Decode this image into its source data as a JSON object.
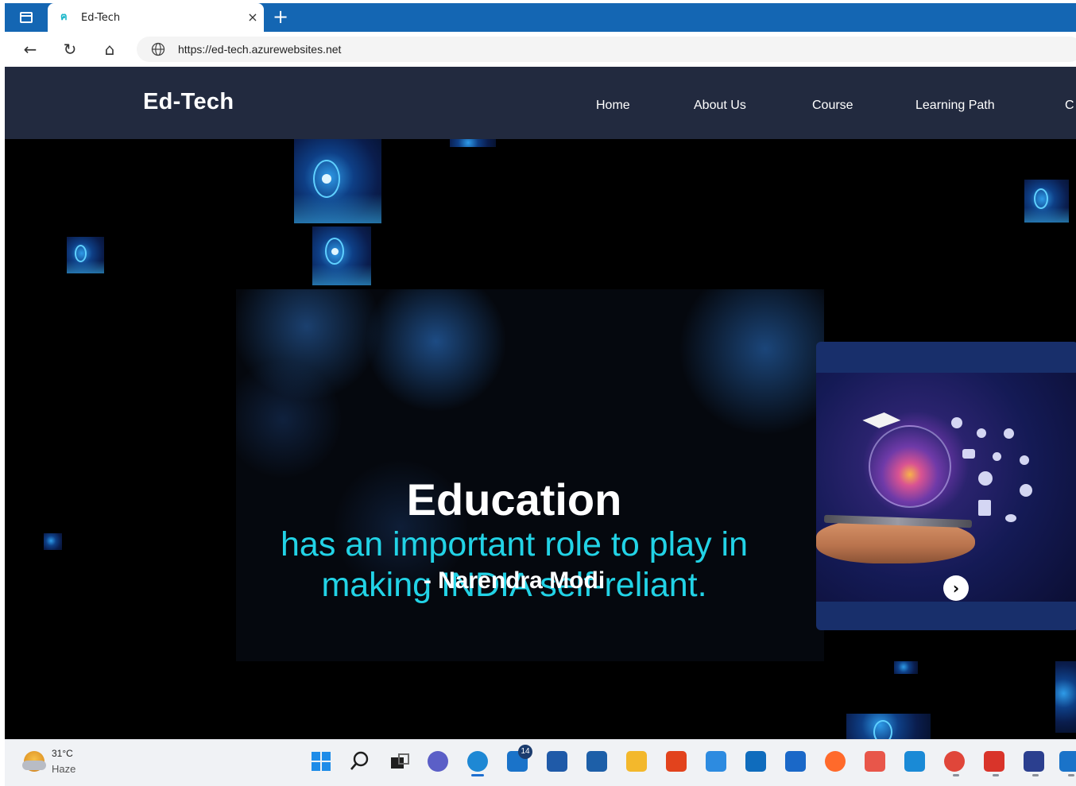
{
  "browser": {
    "tab_title": "Ed-Tech",
    "url": "https://ed-tech.azurewebsites.net",
    "tab_close_glyph": "×",
    "new_tab_glyph": "+",
    "back_glyph": "←",
    "reload_glyph": "↻",
    "home_glyph": "⌂"
  },
  "site": {
    "brand": "Ed-Tech",
    "nav": [
      {
        "label": "Home"
      },
      {
        "label": "About Us"
      },
      {
        "label": "Course"
      },
      {
        "label": "Learning Path"
      },
      {
        "label": "C"
      }
    ],
    "hero": {
      "heading": "Education",
      "quote": "has an important role to play in making INDIA self-reliant.",
      "author": "- Narendra Modi"
    },
    "card": {
      "next_glyph": "›"
    }
  },
  "taskbar": {
    "weather_temp": "31°C",
    "weather_condition": "Haze",
    "mail_badge": "14",
    "apps": [
      {
        "name": "start-icon",
        "color": "#1a8cf0"
      },
      {
        "name": "search-icon",
        "color": "#1f1f1f"
      },
      {
        "name": "task-view-icon",
        "color": "#1f1f1f"
      },
      {
        "name": "teams-chat-icon",
        "color": "#5b5fc7"
      },
      {
        "name": "edge-icon",
        "color": "#1e88d4"
      },
      {
        "name": "mail-icon",
        "color": "#1a73c9"
      },
      {
        "name": "store-icon",
        "color": "#1f5aa8"
      },
      {
        "name": "powershell-icon",
        "color": "#1d5fa8"
      },
      {
        "name": "file-explorer-icon",
        "color": "#f3b82c"
      },
      {
        "name": "office-icon",
        "color": "#e2431d"
      },
      {
        "name": "tips-icon",
        "color": "#2d8be0"
      },
      {
        "name": "outlook-icon",
        "color": "#0f6cbd"
      },
      {
        "name": "defender-icon",
        "color": "#1a68c8"
      },
      {
        "name": "firefox-icon",
        "color": "#ff6a2b"
      },
      {
        "name": "git-icon",
        "color": "#e8564a"
      },
      {
        "name": "vscode-icon",
        "color": "#1a8ad6"
      },
      {
        "name": "chrome-icon",
        "color": "#e0463a"
      },
      {
        "name": "wps-office-icon",
        "color": "#d9342a"
      },
      {
        "name": "word-app-icon",
        "color": "#2b3f8f"
      },
      {
        "name": "app-icon",
        "color": "#1a73c9"
      }
    ]
  },
  "colors": {
    "tabbar": "#1466b3",
    "site_nav": "#222a3f",
    "quote": "#22d3e6",
    "card": "#182f6b"
  }
}
